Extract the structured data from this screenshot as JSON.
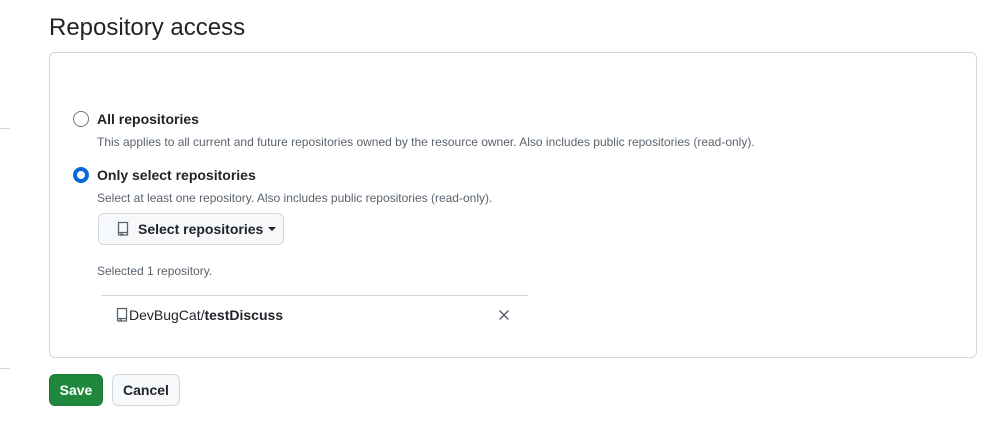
{
  "section": {
    "title": "Repository access"
  },
  "options": [
    {
      "label": "All repositories",
      "description": "This applies to all current and future repositories owned by the resource owner. Also includes public repositories (read-only).",
      "checked": false
    },
    {
      "label": "Only select repositories",
      "description": "Select at least one repository. Also includes public repositories (read-only).",
      "checked": true
    }
  ],
  "select_button": {
    "label": "Select repositories",
    "icon": "repo-icon"
  },
  "selected_summary": "Selected 1 repository.",
  "selected_repos": [
    {
      "owner": "DevBugCat",
      "separator": "/",
      "name": "testDiscuss",
      "icon": "repo-icon"
    }
  ],
  "actions": {
    "save_label": "Save",
    "cancel_label": "Cancel"
  },
  "colors": {
    "accent": "#0969da",
    "save_bg": "#1f883d",
    "border": "#d0d7de"
  }
}
